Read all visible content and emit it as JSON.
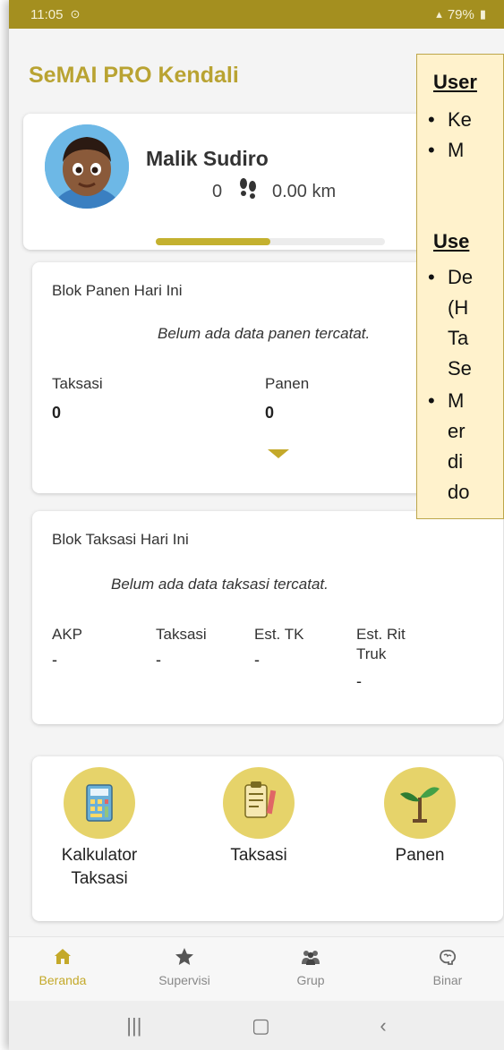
{
  "status_bar": {
    "time": "11:05",
    "battery": "79%"
  },
  "app": {
    "title": "SeMAI PRO Kendali"
  },
  "profile": {
    "name": "Malik Sudiro",
    "steps": "0",
    "distance": "0.00 km"
  },
  "progress": {
    "fraction": 0.5
  },
  "panen_card": {
    "title": "Blok Panen Hari Ini",
    "empty_message": "Belum ada data panen tercatat.",
    "taksasi_label": "Taksasi",
    "taksasi_value": "0",
    "panen_label": "Panen",
    "panen_value": "0"
  },
  "taksasi_card": {
    "title": "Blok Taksasi Hari Ini",
    "empty_message": "Belum ada data taksasi tercatat.",
    "columns": [
      {
        "label": "AKP",
        "value": "-"
      },
      {
        "label": "Taksasi",
        "value": "-"
      },
      {
        "label": "Est. TK",
        "value": "-"
      },
      {
        "label_line1": "Est. Rit",
        "label_line2": "Truk",
        "value": "-"
      }
    ]
  },
  "actions": [
    {
      "label_line1": "Kalkulator",
      "label_line2": "Taksasi",
      "icon": "calculator-icon"
    },
    {
      "label_line1": "Taksasi",
      "label_line2": "",
      "icon": "clipboard-icon"
    },
    {
      "label_line1": "Panen",
      "label_line2": "",
      "icon": "sprout-icon"
    }
  ],
  "bottom_nav": [
    {
      "label": "Beranda",
      "icon": "home-icon",
      "active": true
    },
    {
      "label": "Supervisi",
      "icon": "star-icon",
      "active": false
    },
    {
      "label": "Grup",
      "icon": "group-icon",
      "active": false
    },
    {
      "label": "Binar",
      "icon": "brain-icon",
      "active": false
    }
  ],
  "annotation": {
    "section1_title": "User",
    "section1_items": [
      "Ke",
      "M"
    ],
    "section2_title": "Use",
    "section2_item1_lines": [
      "De",
      "(H",
      "Ta",
      "Se"
    ],
    "section2_item2_lines": [
      "M",
      "er",
      "di",
      "do"
    ]
  },
  "colors": {
    "status_bar": "#a48f1f",
    "brand": "#b9a332",
    "accent": "#c4a92a",
    "action_circle": "#e6d36a",
    "note_background": "#fff2cc"
  }
}
